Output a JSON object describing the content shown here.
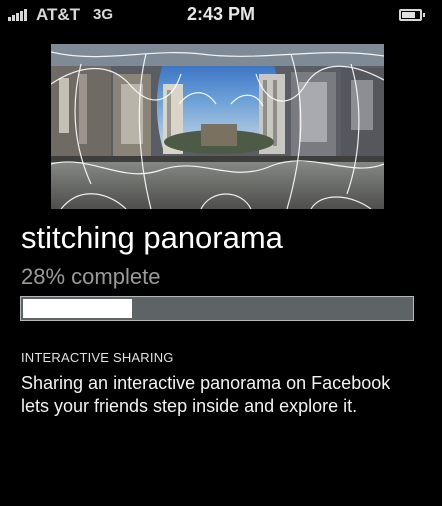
{
  "status_bar": {
    "carrier": "AT&T",
    "network": "3G",
    "time": "2:43 PM",
    "signal_bars": 5,
    "battery_level": 0.75,
    "icon_color": "#d8d8d8"
  },
  "panorama": {
    "icon": "panorama-thumbnail"
  },
  "stitching": {
    "title": "stitching panorama",
    "progress_percent": "28%",
    "progress_suffix": " complete",
    "progress_fraction": 0.28,
    "bar_track_color": "#5e6466",
    "bar_fill_color": "#ffffff"
  },
  "sharing": {
    "heading": "INTERACTIVE SHARING",
    "line1": "Sharing an interactive panorama on Facebook",
    "line2": "lets your friends step inside and explore it."
  }
}
